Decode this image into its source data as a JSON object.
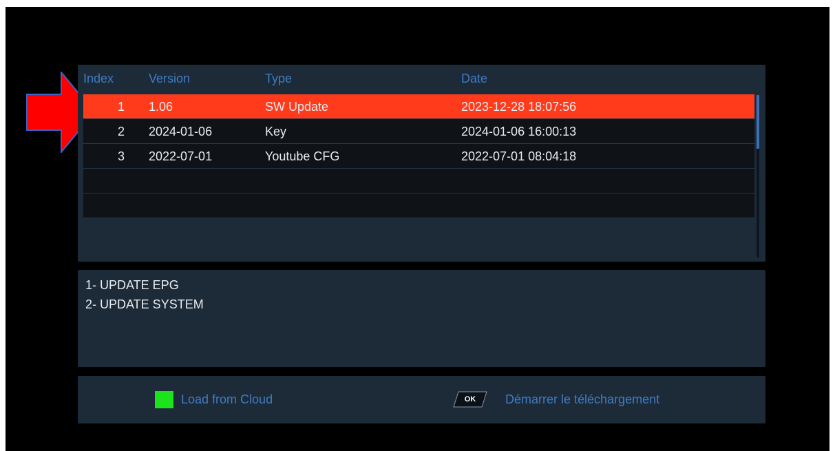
{
  "list": {
    "headers": {
      "index": "Index",
      "version": "Version",
      "type": "Type",
      "date": "Date"
    },
    "rows": [
      {
        "index": "1",
        "version": "1.06",
        "type": "SW Update",
        "date": "2023-12-28 18:07:56",
        "selected": true
      },
      {
        "index": "2",
        "version": "2024-01-06",
        "type": "Key",
        "date": "2024-01-06 16:00:13",
        "selected": false
      },
      {
        "index": "3",
        "version": "2022-07-01",
        "type": "Youtube CFG",
        "date": "2022-07-01 08:04:18",
        "selected": false
      },
      {
        "index": "",
        "version": "",
        "type": "",
        "date": "",
        "selected": false
      },
      {
        "index": "",
        "version": "",
        "type": "",
        "date": "",
        "selected": false
      }
    ]
  },
  "info": {
    "lines": [
      "1- UPDATE EPG",
      "2- UPDATE SYSTEM"
    ]
  },
  "footer": {
    "green_key_label": "Load from Cloud",
    "ok_key_text": "OK",
    "ok_key_label": "Démarrer le téléchargement"
  },
  "colors": {
    "panel": "#1d2b39",
    "selected_row": "#ff3b1c",
    "header_text": "#3f7cc2",
    "green_key": "#1de31d",
    "arrow": "#ff0000"
  },
  "icons": {
    "pointer_arrow": "arrow-right-icon",
    "green_button": "green-key-icon",
    "ok_button": "ok-key-icon"
  }
}
